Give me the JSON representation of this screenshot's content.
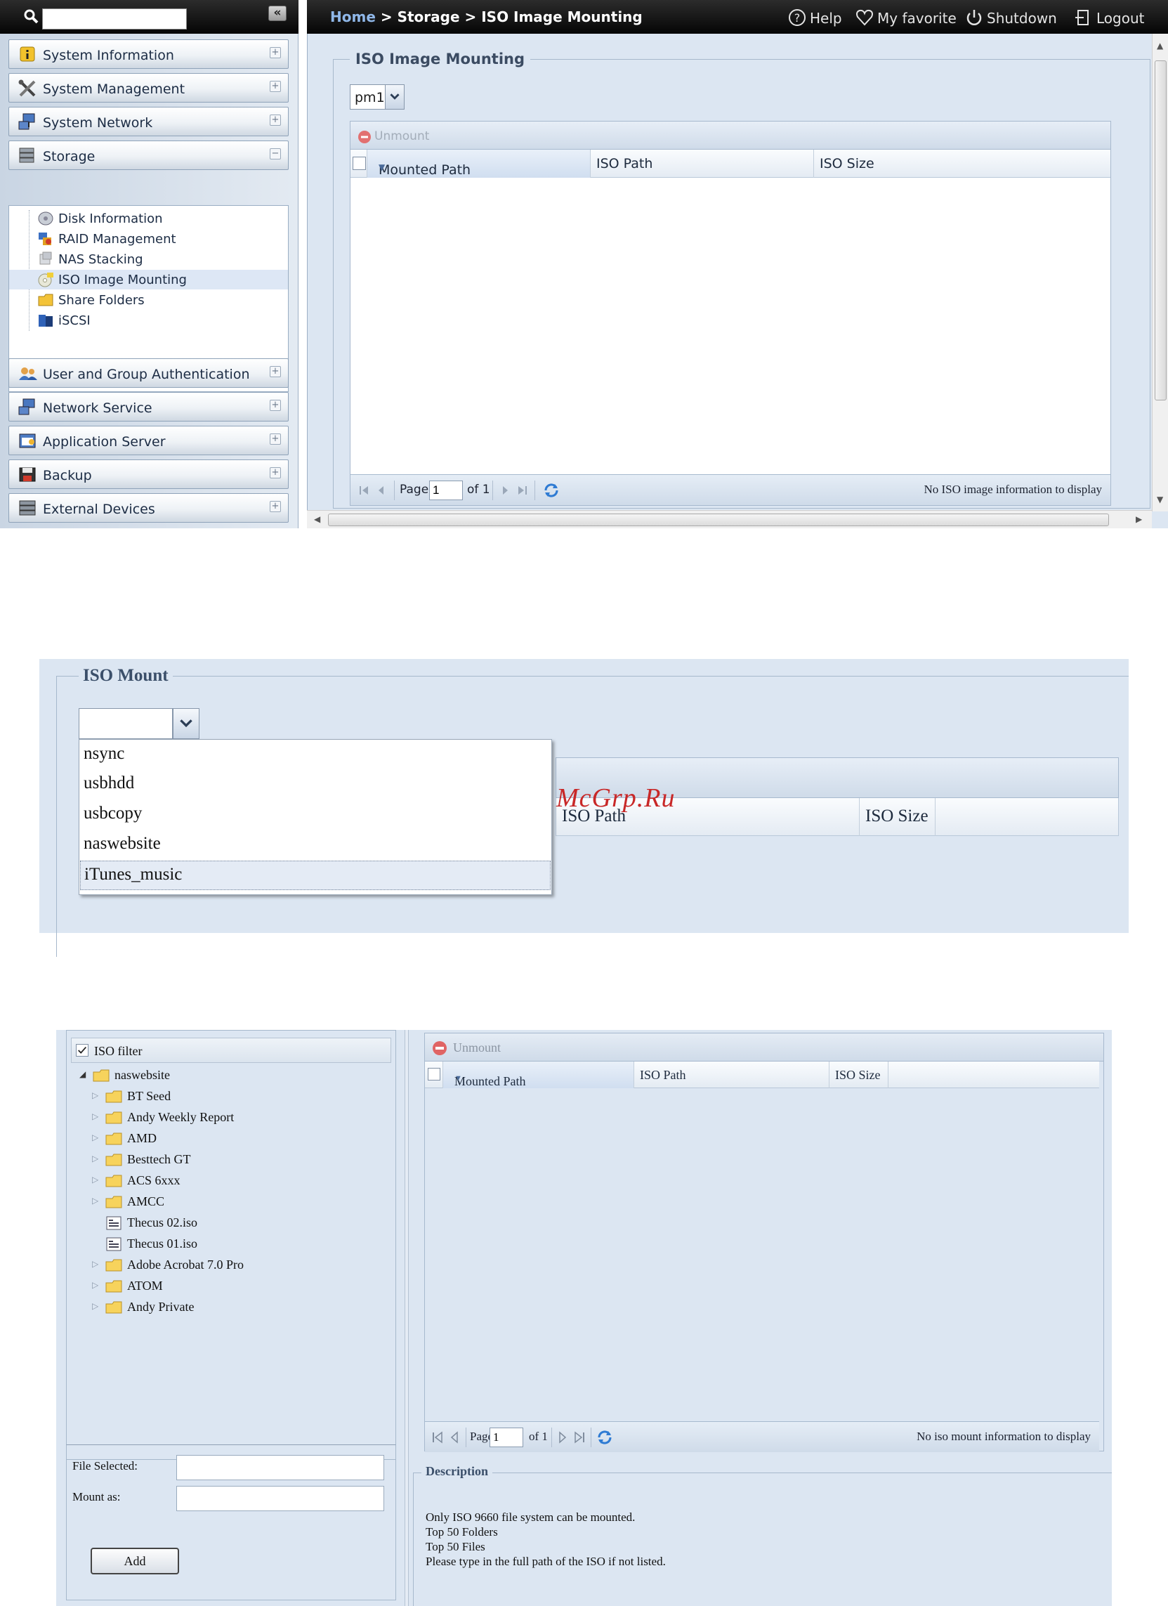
{
  "screen1": {
    "search": {
      "placeholder": ""
    },
    "collapse_label": "«",
    "breadcrumb": {
      "home": "Home",
      "sep1": " > ",
      "storage": "Storage",
      "sep2": " > ",
      "page": "ISO Image Mounting"
    },
    "top_links": {
      "help": "Help",
      "favorite": "My favorite",
      "shutdown": "Shutdown",
      "logout": "Logout"
    },
    "sidebar": {
      "sections": [
        {
          "label": "System Information",
          "icon": "info-icon"
        },
        {
          "label": "System Management",
          "icon": "tools-icon"
        },
        {
          "label": "System Network",
          "icon": "network-icon"
        },
        {
          "label": "Storage",
          "icon": "storage-icon"
        },
        {
          "label": "User and Group Authentication",
          "icon": "users-icon"
        },
        {
          "label": "Network Service",
          "icon": "network-service-icon"
        },
        {
          "label": "Application Server",
          "icon": "app-server-icon"
        },
        {
          "label": "Backup",
          "icon": "backup-icon"
        },
        {
          "label": "External Devices",
          "icon": "external-devices-icon"
        }
      ],
      "storage_items": [
        {
          "label": "Disk Information",
          "icon": "disk-icon"
        },
        {
          "label": "RAID Management",
          "icon": "raid-icon"
        },
        {
          "label": "NAS Stacking",
          "icon": "stacking-icon"
        },
        {
          "label": "ISO Image Mounting",
          "icon": "iso-icon",
          "selected": true
        },
        {
          "label": "Share Folders",
          "icon": "folder-icon"
        },
        {
          "label": "iSCSI",
          "icon": "iscsi-icon"
        }
      ]
    },
    "main": {
      "legend": "ISO Image Mounting",
      "select_value": "pm1",
      "unmount_label": "Unmount",
      "columns": [
        "Mounted Path",
        "ISO Path",
        "ISO Size"
      ],
      "pager": {
        "page_label": "Page",
        "page_value": "1",
        "of_label": "of 1",
        "status": "No ISO image information to display"
      }
    }
  },
  "screen2": {
    "legend": "ISO Mount",
    "select_value": "",
    "dropdown_options": [
      "nsync",
      "usbhdd",
      "usbcopy",
      "naswebsite",
      "iTunes_music"
    ],
    "highlighted_option": "iTunes_music",
    "columns": [
      "ISO Path",
      "ISO Size"
    ],
    "watermark": "McGrp.Ru"
  },
  "screen3": {
    "tree": {
      "filter_label": "ISO filter",
      "filter_checked": true,
      "root": "naswebsite",
      "children": [
        {
          "label": "BT Seed",
          "type": "folder"
        },
        {
          "label": "Andy Weekly Report",
          "type": "folder"
        },
        {
          "label": "AMD",
          "type": "folder"
        },
        {
          "label": "Besttech GT",
          "type": "folder"
        },
        {
          "label": "ACS 6xxx",
          "type": "folder"
        },
        {
          "label": "AMCC",
          "type": "folder"
        },
        {
          "label": "Thecus 02.iso",
          "type": "file"
        },
        {
          "label": "Thecus 01.iso",
          "type": "file"
        },
        {
          "label": "Adobe Acrobat 7.0 Pro",
          "type": "folder"
        },
        {
          "label": "ATOM",
          "type": "folder"
        },
        {
          "label": "Andy Private",
          "type": "folder"
        }
      ]
    },
    "form": {
      "file_selected_label": "File Selected:",
      "mount_as_label": "Mount as:",
      "add_label": "Add"
    },
    "grid": {
      "unmount_label": "Unmount",
      "columns": [
        "Mounted Path",
        "ISO Path",
        "ISO Size"
      ],
      "pager": {
        "page_label": "Page",
        "page_value": "1",
        "of_label": "of 1",
        "status": "No iso mount information to display"
      }
    },
    "description": {
      "legend": "Description",
      "lines": [
        "Only ISO 9660 file system can be mounted.",
        "Top 50 Folders",
        "Top 50 Files",
        "Please type in the full path of the ISO if not listed."
      ]
    }
  }
}
